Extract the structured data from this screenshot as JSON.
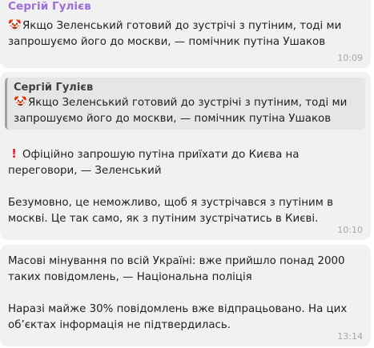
{
  "messages": [
    {
      "sender": "Сергій Гулієв",
      "icon": "clown-face",
      "text": "Якщо Зеленський готовий до зустрічі з путіним, тоді ми запрошуємо його до москви, — помічник путіна Ушаков",
      "time": "10:09"
    },
    {
      "reply": {
        "sender": "Сергій Гулієв",
        "icon": "clown-face",
        "text": "Якщо Зеленський готовий до зустрічі з путіним, тоді ми запрошуємо його до москви, — помічник путіна Ушаков"
      },
      "icon": "exclamation-mark",
      "text1": "Офіційно запрошую путіна приїхати до Києва на переговори, — Зеленський",
      "text2": "Безумовно, це неможливо, щоб я зустрічався з путіним в москві. Це так само, як з путіним зустрічатись в Києві.",
      "time": "10:10"
    },
    {
      "text1": "Масові мінування по всій Україні: вже прийшло понад 2000 таких повідомлень, — Національна поліція",
      "text2": "Наразі майже 30% повідомлень вже відпрацьовано. На цих об’єктах інформація не підтвердилась.",
      "time": "13:14"
    }
  ]
}
